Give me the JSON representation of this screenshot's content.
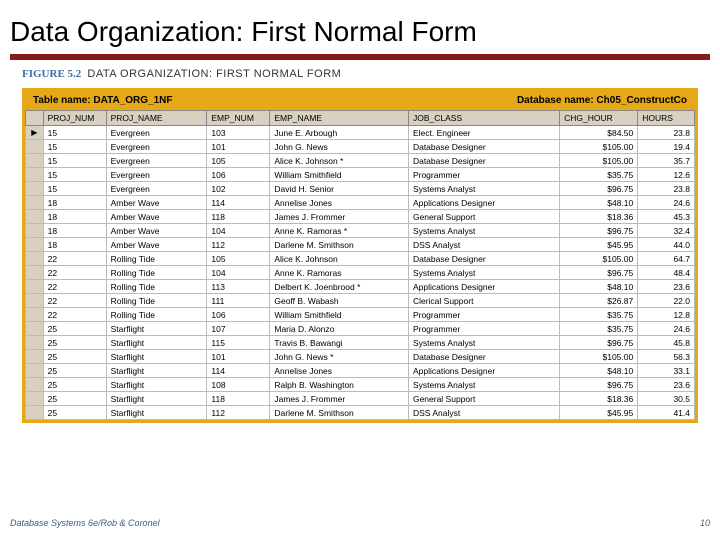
{
  "slide": {
    "title": "Data Organization: First Normal Form",
    "figure_label": "FIGURE 5.2",
    "figure_title": "DATA ORGANIZATION: FIRST NORMAL FORM"
  },
  "table_meta": {
    "table_name_label": "Table name: DATA_ORG_1NF",
    "db_name_label": "Database name: Ch05_ConstructCo"
  },
  "columns": [
    "PROJ_NUM",
    "PROJ_NAME",
    "EMP_NUM",
    "EMP_NAME",
    "JOB_CLASS",
    "CHG_HOUR",
    "HOURS"
  ],
  "rows": [
    {
      "proj_num": "15",
      "proj_name": "Evergreen",
      "emp_num": "103",
      "emp_name": "June E. Arbough",
      "job_class": "Elect. Engineer",
      "chg_hour": "$84.50",
      "hours": "23.8",
      "active": true
    },
    {
      "proj_num": "15",
      "proj_name": "Evergreen",
      "emp_num": "101",
      "emp_name": "John G. News",
      "job_class": "Database Designer",
      "chg_hour": "$105.00",
      "hours": "19.4"
    },
    {
      "proj_num": "15",
      "proj_name": "Evergreen",
      "emp_num": "105",
      "emp_name": "Alice K. Johnson *",
      "job_class": "Database Designer",
      "chg_hour": "$105.00",
      "hours": "35.7"
    },
    {
      "proj_num": "15",
      "proj_name": "Evergreen",
      "emp_num": "106",
      "emp_name": "William Smithfield",
      "job_class": "Programmer",
      "chg_hour": "$35.75",
      "hours": "12.6"
    },
    {
      "proj_num": "15",
      "proj_name": "Evergreen",
      "emp_num": "102",
      "emp_name": "David H. Senior",
      "job_class": "Systems Analyst",
      "chg_hour": "$96.75",
      "hours": "23.8"
    },
    {
      "proj_num": "18",
      "proj_name": "Amber Wave",
      "emp_num": "114",
      "emp_name": "Annelise Jones",
      "job_class": "Applications Designer",
      "chg_hour": "$48.10",
      "hours": "24.6"
    },
    {
      "proj_num": "18",
      "proj_name": "Amber Wave",
      "emp_num": "118",
      "emp_name": "James J. Frommer",
      "job_class": "General Support",
      "chg_hour": "$18.36",
      "hours": "45.3"
    },
    {
      "proj_num": "18",
      "proj_name": "Amber Wave",
      "emp_num": "104",
      "emp_name": "Anne K. Ramoras *",
      "job_class": "Systems Analyst",
      "chg_hour": "$96.75",
      "hours": "32.4"
    },
    {
      "proj_num": "18",
      "proj_name": "Amber Wave",
      "emp_num": "112",
      "emp_name": "Darlene M. Smithson",
      "job_class": "DSS Analyst",
      "chg_hour": "$45.95",
      "hours": "44.0"
    },
    {
      "proj_num": "22",
      "proj_name": "Rolling Tide",
      "emp_num": "105",
      "emp_name": "Alice K. Johnson",
      "job_class": "Database Designer",
      "chg_hour": "$105.00",
      "hours": "64.7"
    },
    {
      "proj_num": "22",
      "proj_name": "Rolling Tide",
      "emp_num": "104",
      "emp_name": "Anne K. Ramoras",
      "job_class": "Systems Analyst",
      "chg_hour": "$96.75",
      "hours": "48.4"
    },
    {
      "proj_num": "22",
      "proj_name": "Rolling Tide",
      "emp_num": "113",
      "emp_name": "Delbert K. Joenbrood *",
      "job_class": "Applications Designer",
      "chg_hour": "$48.10",
      "hours": "23.6"
    },
    {
      "proj_num": "22",
      "proj_name": "Rolling Tide",
      "emp_num": "111",
      "emp_name": "Geoff B. Wabash",
      "job_class": "Clerical Support",
      "chg_hour": "$26.87",
      "hours": "22.0"
    },
    {
      "proj_num": "22",
      "proj_name": "Rolling Tide",
      "emp_num": "106",
      "emp_name": "William Smithfield",
      "job_class": "Programmer",
      "chg_hour": "$35.75",
      "hours": "12.8"
    },
    {
      "proj_num": "25",
      "proj_name": "Starflight",
      "emp_num": "107",
      "emp_name": "Maria D. Alonzo",
      "job_class": "Programmer",
      "chg_hour": "$35.75",
      "hours": "24.6"
    },
    {
      "proj_num": "25",
      "proj_name": "Starflight",
      "emp_num": "115",
      "emp_name": "Travis B. Bawangi",
      "job_class": "Systems Analyst",
      "chg_hour": "$96.75",
      "hours": "45.8"
    },
    {
      "proj_num": "25",
      "proj_name": "Starflight",
      "emp_num": "101",
      "emp_name": "John G. News *",
      "job_class": "Database Designer",
      "chg_hour": "$105.00",
      "hours": "56.3"
    },
    {
      "proj_num": "25",
      "proj_name": "Starflight",
      "emp_num": "114",
      "emp_name": "Annelise Jones",
      "job_class": "Applications Designer",
      "chg_hour": "$48.10",
      "hours": "33.1"
    },
    {
      "proj_num": "25",
      "proj_name": "Starflight",
      "emp_num": "108",
      "emp_name": "Ralph B. Washington",
      "job_class": "Systems Analyst",
      "chg_hour": "$96.75",
      "hours": "23.6"
    },
    {
      "proj_num": "25",
      "proj_name": "Starflight",
      "emp_num": "118",
      "emp_name": "James J. Frommer",
      "job_class": "General Support",
      "chg_hour": "$18.36",
      "hours": "30.5"
    },
    {
      "proj_num": "25",
      "proj_name": "Starflight",
      "emp_num": "112",
      "emp_name": "Darlene M. Smithson",
      "job_class": "DSS Analyst",
      "chg_hour": "$45.95",
      "hours": "41.4"
    }
  ],
  "footer": {
    "left": "Database Systems 6e/Rob & Coronel",
    "right": "10"
  }
}
